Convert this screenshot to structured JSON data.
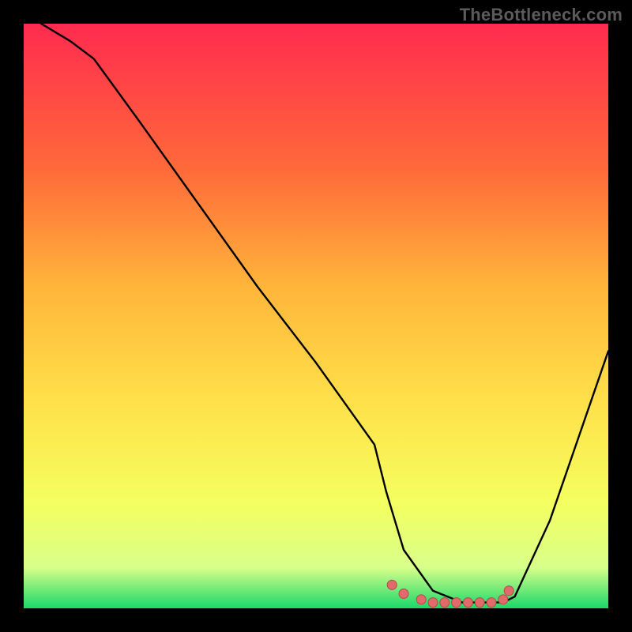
{
  "watermark": "TheBottleneck.com",
  "colors": {
    "page_bg": "#000000",
    "gradient_top": "#ff2b4f",
    "gradient_mid1": "#ff6a3a",
    "gradient_mid2": "#ffb53a",
    "gradient_mid3": "#ffe14a",
    "gradient_mid4": "#f4ff60",
    "gradient_mid5": "#d8ff8a",
    "gradient_bot": "#1bd86a",
    "curve": "#000000",
    "marker_fill": "#e26a6a",
    "marker_stroke": "#b24a4a"
  },
  "chart_data": {
    "type": "line",
    "title": "",
    "xlabel": "",
    "ylabel": "",
    "xlim": [
      0,
      100
    ],
    "ylim": [
      0,
      100
    ],
    "grid": true,
    "legend": false,
    "series": [
      {
        "name": "curve",
        "x": [
          3,
          8,
          12,
          20,
          30,
          40,
          50,
          60,
          62,
          65,
          70,
          75,
          80,
          82,
          84,
          90,
          100
        ],
        "y": [
          100,
          97,
          94,
          83,
          69,
          55,
          42,
          28,
          20,
          10,
          3,
          1,
          1,
          1,
          2,
          15,
          44
        ]
      }
    ],
    "markers": {
      "name": "highlight-dots",
      "x": [
        63,
        65,
        68,
        70,
        72,
        74,
        76,
        78,
        80,
        82,
        83
      ],
      "y": [
        4,
        2.5,
        1.5,
        1,
        1,
        1,
        1,
        1,
        1,
        1.5,
        3
      ]
    }
  }
}
